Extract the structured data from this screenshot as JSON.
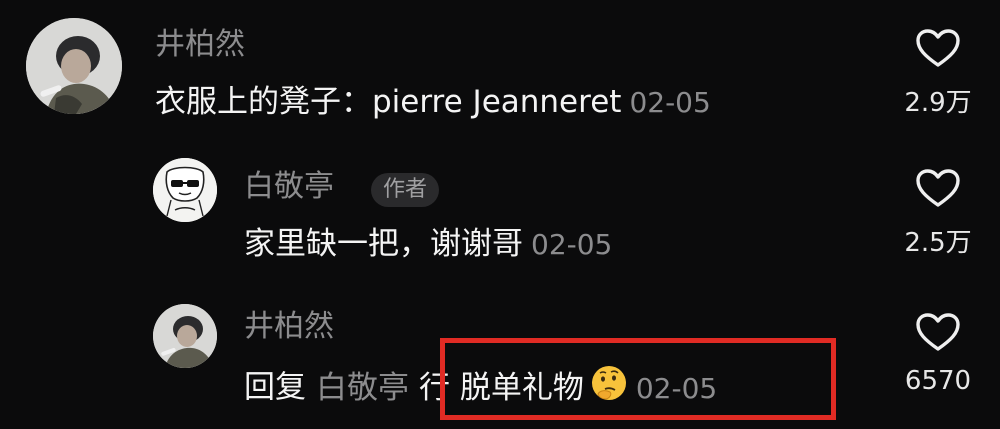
{
  "comments": [
    {
      "username": "井柏然",
      "text": "衣服上的凳子：pierre Jeanneret",
      "date": "02-05",
      "like_count": "2.9万"
    },
    {
      "username": "白敬亭",
      "badge": "作者",
      "text": "家里缺一把，谢谢哥",
      "date": "02-05",
      "like_count": "2.5万"
    },
    {
      "username": "井柏然",
      "reply_prefix": "回复",
      "reply_target": "白敬亭",
      "text": "行 脱单礼物",
      "emoji": "thinking-face-emoji",
      "date": "02-05",
      "like_count": "6570"
    }
  ],
  "icons": {
    "like": "heart-outline-icon"
  },
  "colors": {
    "background": "#0b0b0c",
    "username": "#8c8c8e",
    "text": "#f4f4f4",
    "highlight": "#e12b24"
  }
}
